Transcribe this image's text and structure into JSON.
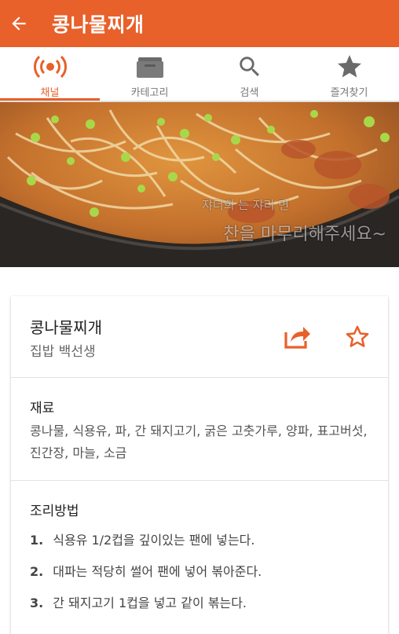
{
  "app_bar": {
    "title": "콩나물찌개",
    "background": "#e8602a",
    "back_icon": "arrow-left-icon"
  },
  "tabs": [
    {
      "label": "채널",
      "icon": "broadcast-icon",
      "active": true
    },
    {
      "label": "카테고리",
      "icon": "folder-icon",
      "active": false
    },
    {
      "label": "검색",
      "icon": "search-icon",
      "active": false
    },
    {
      "label": "즐겨찾기",
      "icon": "star-icon",
      "active": false
    }
  ],
  "video": {
    "caption_small": "쟈더희 는 쟈리 면",
    "caption_large": "찬을 마무리해주세요~"
  },
  "recipe": {
    "title": "콩나물찌개",
    "author": "집밥 백선생",
    "share_icon": "share-icon",
    "favorite_icon": "star-outline-icon"
  },
  "ingredients": {
    "heading": "재료",
    "text": "콩나물, 식용유, 파, 간 돼지고기, 굵은 고춧가루, 양파, 표고버섯, 진간장, 마늘, 소금"
  },
  "method": {
    "heading": "조리방법",
    "steps": [
      {
        "num": "1.",
        "text": "식용유 1/2컵을 깊이있는 팬에 넣는다."
      },
      {
        "num": "2.",
        "text": "대파는 적당히 썰어 팬에 넣어 볶아준다."
      },
      {
        "num": "3.",
        "text": "간 돼지고기 1컵을 넣고 같이 볶는다."
      }
    ]
  }
}
